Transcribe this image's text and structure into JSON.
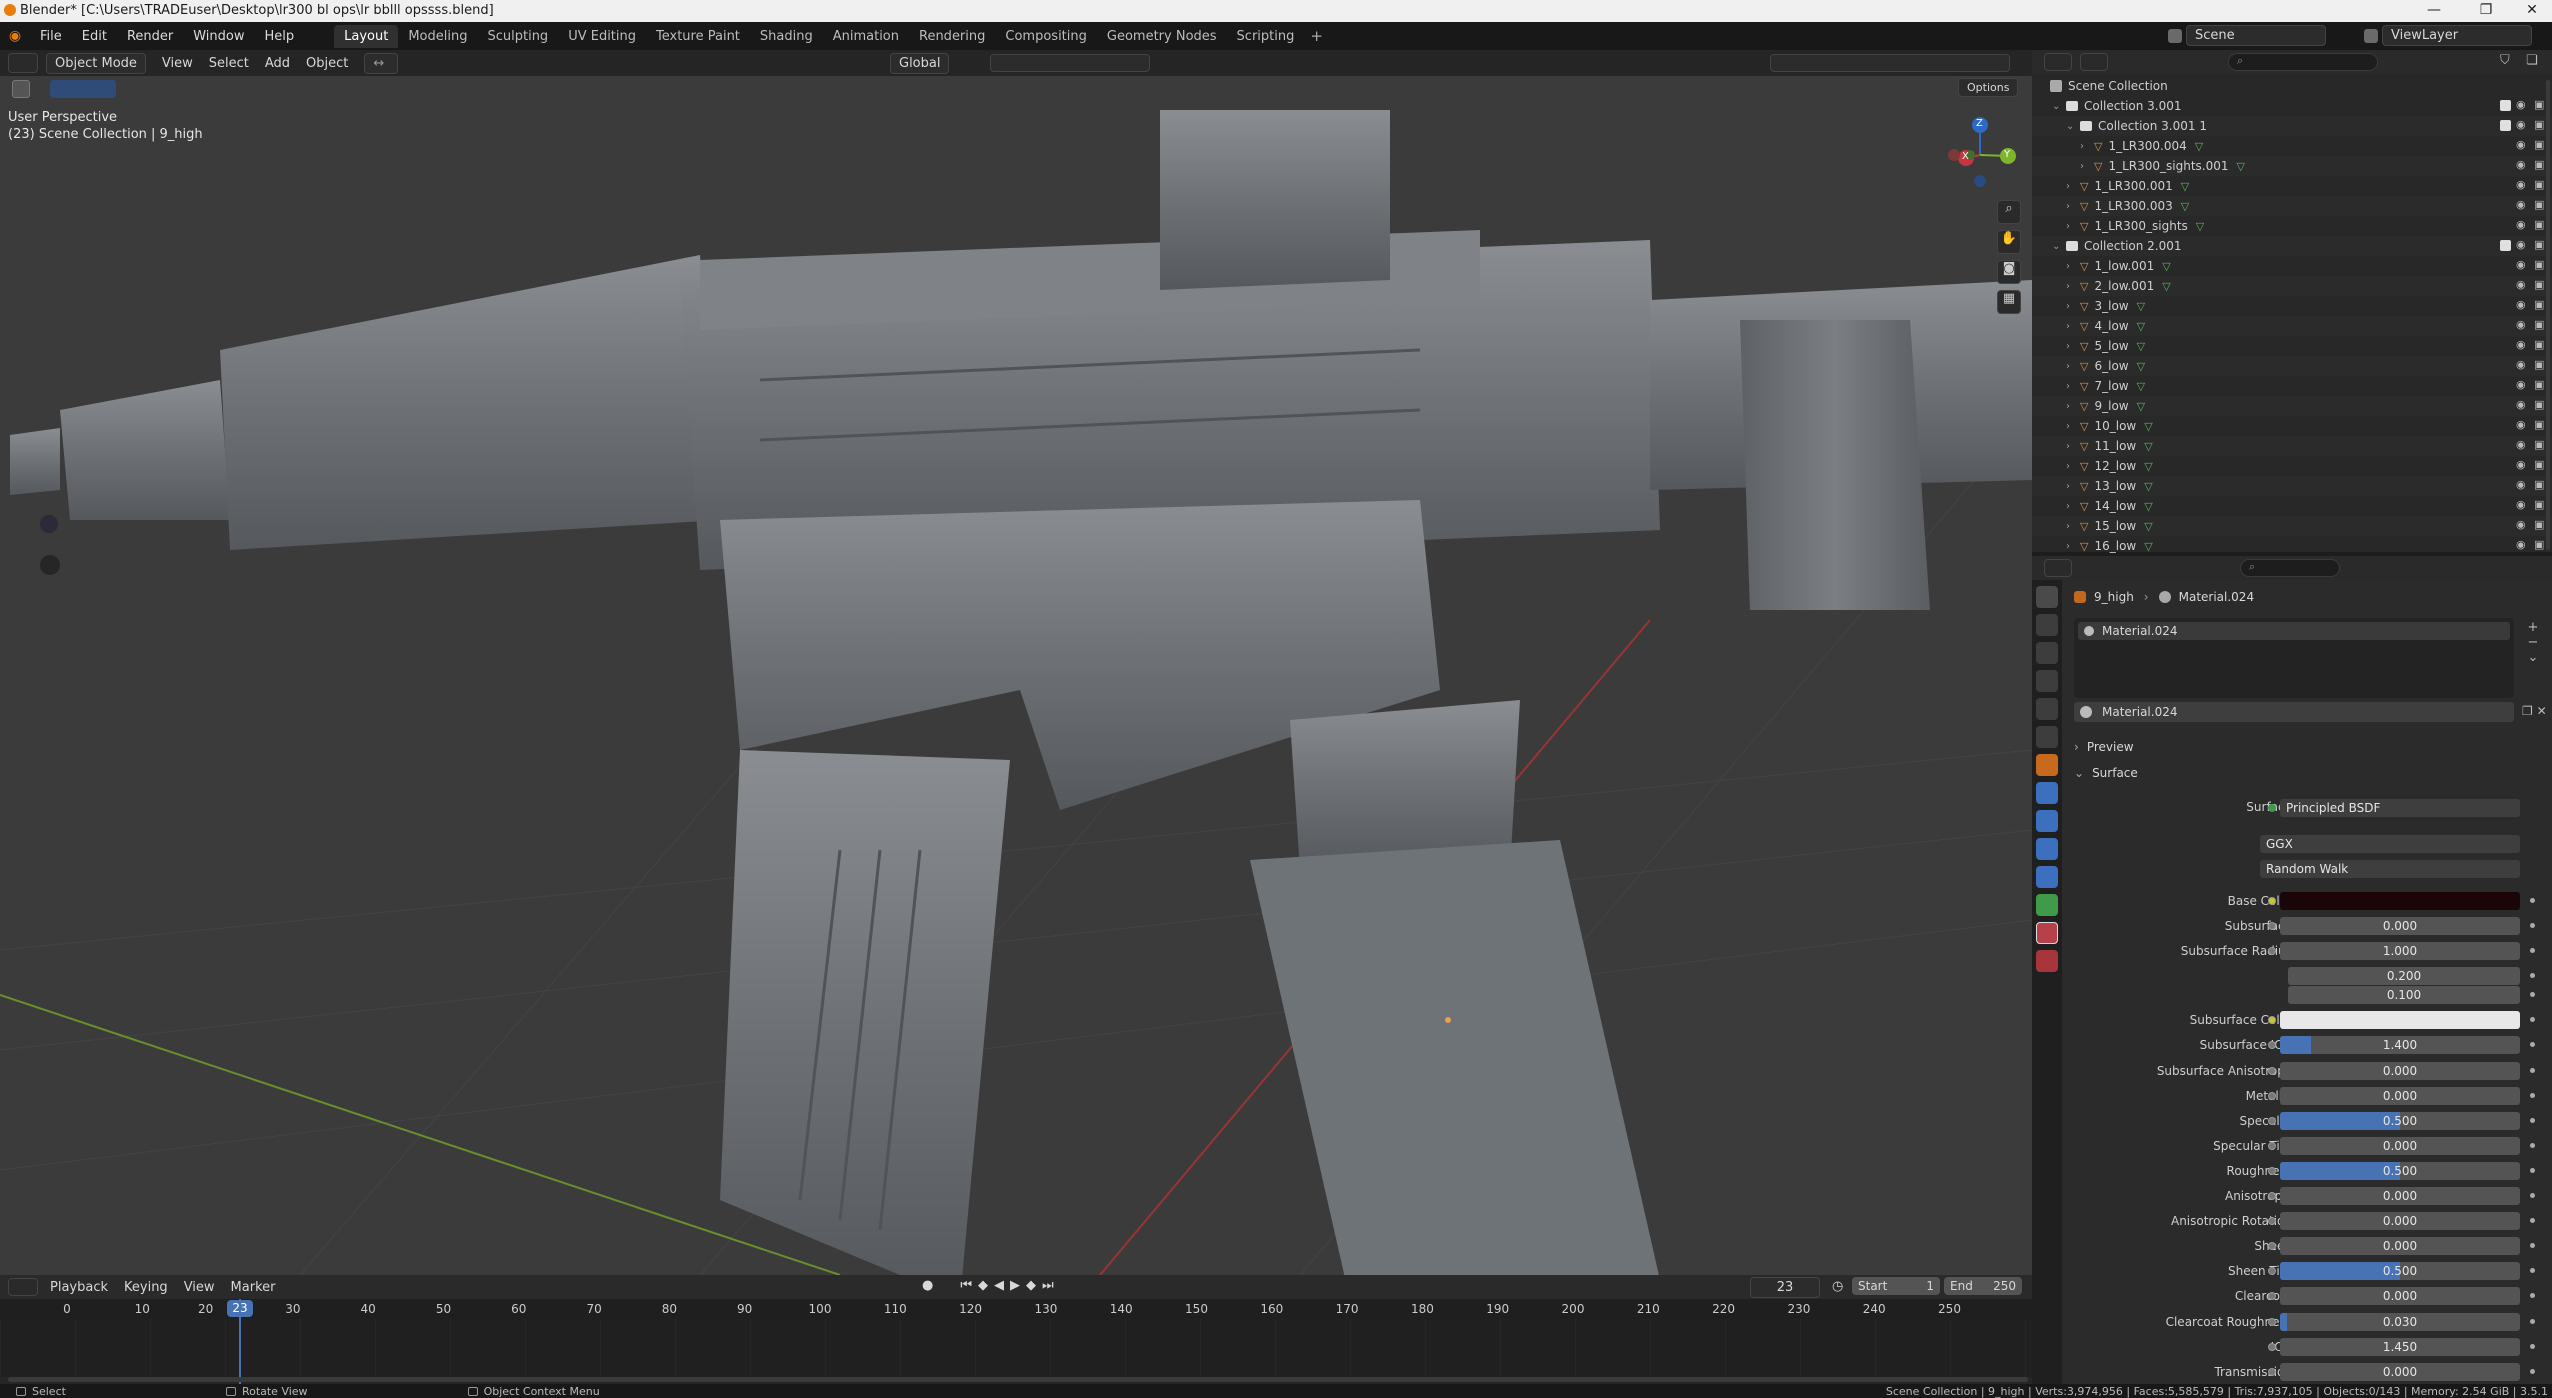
{
  "window": {
    "title": "Blender* [C:\\Users\\TRADEuser\\Desktop\\lr300 bl ops\\lr bblll opssss.blend]"
  },
  "menu": [
    "File",
    "Edit",
    "Render",
    "Window",
    "Help"
  ],
  "workspaces": [
    "Layout",
    "Modeling",
    "Sculpting",
    "UV Editing",
    "Texture Paint",
    "Shading",
    "Animation",
    "Rendering",
    "Compositing",
    "Geometry Nodes",
    "Scripting"
  ],
  "scene": {
    "name": "Scene",
    "view_layer": "ViewLayer"
  },
  "viewport": {
    "mode": "Object Mode",
    "menus": [
      "View",
      "Select",
      "Add",
      "Object"
    ],
    "transform": "Global",
    "options": "Options",
    "overlay_title": "User Perspective",
    "overlay_sub": "(23) Scene Collection | 9_high",
    "gizmo": {
      "x": "X",
      "y": "Y",
      "z": "Z"
    }
  },
  "timeline": {
    "menus": [
      "Playback",
      "Keying",
      "View",
      "Marker"
    ],
    "current_frame": "23",
    "start_label": "Start",
    "start": "1",
    "end_label": "End",
    "end": "250",
    "ticks": [
      "0",
      "10",
      "20",
      "30",
      "40",
      "50",
      "60",
      "70",
      "80",
      "90",
      "100",
      "110",
      "120",
      "130",
      "140",
      "150",
      "160",
      "170",
      "180",
      "190",
      "200",
      "210",
      "220",
      "230",
      "240",
      "250"
    ]
  },
  "status": {
    "select": "Select",
    "rotate": "Rotate View",
    "context": "Object Context Menu",
    "stats": "Scene Collection | 9_high | Verts:3,974,956 | Faces:5,585,579 | Tris:7,937,105 | Objects:0/143 | Memory: 2.54 GiB | 3.5.1"
  },
  "outliner": {
    "root": "Scene Collection",
    "rows": [
      {
        "name": "Collection 3.001",
        "indent": 1,
        "type": "collection",
        "expanded": true,
        "check": true
      },
      {
        "name": "Collection 3.001 1",
        "indent": 2,
        "type": "collection",
        "expanded": true,
        "check": true
      },
      {
        "name": "1_LR300.004",
        "indent": 3,
        "type": "mesh"
      },
      {
        "name": "1_LR300_sights.001",
        "indent": 3,
        "type": "mesh"
      },
      {
        "name": "1_LR300.001",
        "indent": 2,
        "type": "mesh"
      },
      {
        "name": "1_LR300.003",
        "indent": 2,
        "type": "mesh"
      },
      {
        "name": "1_LR300_sights",
        "indent": 2,
        "type": "mesh"
      },
      {
        "name": "Collection 2.001",
        "indent": 1,
        "type": "collection",
        "expanded": true,
        "check": true
      },
      {
        "name": "1_low.001",
        "indent": 2,
        "type": "mesh"
      },
      {
        "name": "2_low.001",
        "indent": 2,
        "type": "mesh"
      },
      {
        "name": "3_low",
        "indent": 2,
        "type": "mesh"
      },
      {
        "name": "4_low",
        "indent": 2,
        "type": "mesh"
      },
      {
        "name": "5_low",
        "indent": 2,
        "type": "mesh"
      },
      {
        "name": "6_low",
        "indent": 2,
        "type": "mesh"
      },
      {
        "name": "7_low",
        "indent": 2,
        "type": "mesh"
      },
      {
        "name": "9_low",
        "indent": 2,
        "type": "mesh"
      },
      {
        "name": "10_low",
        "indent": 2,
        "type": "mesh"
      },
      {
        "name": "11_low",
        "indent": 2,
        "type": "mesh"
      },
      {
        "name": "12_low",
        "indent": 2,
        "type": "mesh"
      },
      {
        "name": "13_low",
        "indent": 2,
        "type": "mesh"
      },
      {
        "name": "14_low",
        "indent": 2,
        "type": "mesh"
      },
      {
        "name": "15_low",
        "indent": 2,
        "type": "mesh"
      },
      {
        "name": "16_low",
        "indent": 2,
        "type": "mesh"
      }
    ]
  },
  "properties": {
    "breadcrumb_object": "9_high",
    "breadcrumb_material": "Material.024",
    "slot": "Material.024",
    "material_name": "Material.024",
    "preview_label": "Preview",
    "surface_label": "Surface",
    "surface_shader": "Principled BSDF",
    "distribution": "GGX",
    "subsurface_method": "Random Walk",
    "fields": [
      {
        "label": "Base Color",
        "type": "color",
        "color": "#1a0509"
      },
      {
        "label": "Subsurface",
        "value": "0.000",
        "fill": 0
      },
      {
        "label": "Subsurface Radius",
        "value": "1.000",
        "fill": 0
      },
      {
        "label": "",
        "value": "0.200",
        "fill": 0
      },
      {
        "label": "",
        "value": "0.100",
        "fill": 0
      },
      {
        "label": "Subsurface Color",
        "type": "color",
        "color": "#e8e8e8"
      },
      {
        "label": "Subsurface IOR",
        "value": "1.400",
        "fill": 0.13
      },
      {
        "label": "Subsurface Anisotropy",
        "value": "0.000",
        "fill": 0
      },
      {
        "label": "Metallic",
        "value": "0.000",
        "fill": 0
      },
      {
        "label": "Specular",
        "value": "0.500",
        "fill": 0.5
      },
      {
        "label": "Specular Tint",
        "value": "0.000",
        "fill": 0
      },
      {
        "label": "Roughness",
        "value": "0.500",
        "fill": 0.5
      },
      {
        "label": "Anisotropic",
        "value": "0.000",
        "fill": 0
      },
      {
        "label": "Anisotropic Rotation",
        "value": "0.000",
        "fill": 0
      },
      {
        "label": "Sheen",
        "value": "0.000",
        "fill": 0
      },
      {
        "label": "Sheen Tint",
        "value": "0.500",
        "fill": 0.5
      },
      {
        "label": "Clearcoat",
        "value": "0.000",
        "fill": 0
      },
      {
        "label": "Clearcoat Roughness",
        "value": "0.030",
        "fill": 0.03
      },
      {
        "label": "IOR",
        "value": "1.450",
        "fill": 0
      },
      {
        "label": "Transmission",
        "value": "0.000",
        "fill": 0
      }
    ]
  }
}
